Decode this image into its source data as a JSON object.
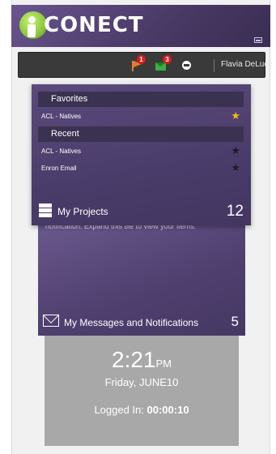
{
  "app": {
    "logo_text": "CONECT"
  },
  "toolbar": {
    "flag_badge": "1",
    "messages_badge": "3",
    "user_name": "Flavia DeLuce"
  },
  "projects_tile": {
    "favorites_label": "Favorites",
    "favorites": [
      {
        "name": "ACL - Natives",
        "starred": true
      }
    ],
    "recent_label": "Recent",
    "recent": [
      {
        "name": "ACL - Natives",
        "starred": false
      },
      {
        "name": "Enron Email",
        "starred": false
      }
    ],
    "title": "My Projects",
    "count": "12"
  },
  "messages_tile": {
    "text": "notification. Expand this tile to view your items.",
    "title": "My Messages and Notifications",
    "count": "5"
  },
  "clock_tile": {
    "time": "2:21",
    "ampm": "PM",
    "date": "Friday, JUNE10",
    "logged_label": "Logged In:",
    "logged_value": "00:00:10"
  },
  "colors": {
    "header": "#5a4a7c",
    "tile": "#4e3f6f",
    "accent_green": "#8cc63f",
    "star_gold": "#f5b914",
    "clock_bg": "#a8a8a8"
  }
}
